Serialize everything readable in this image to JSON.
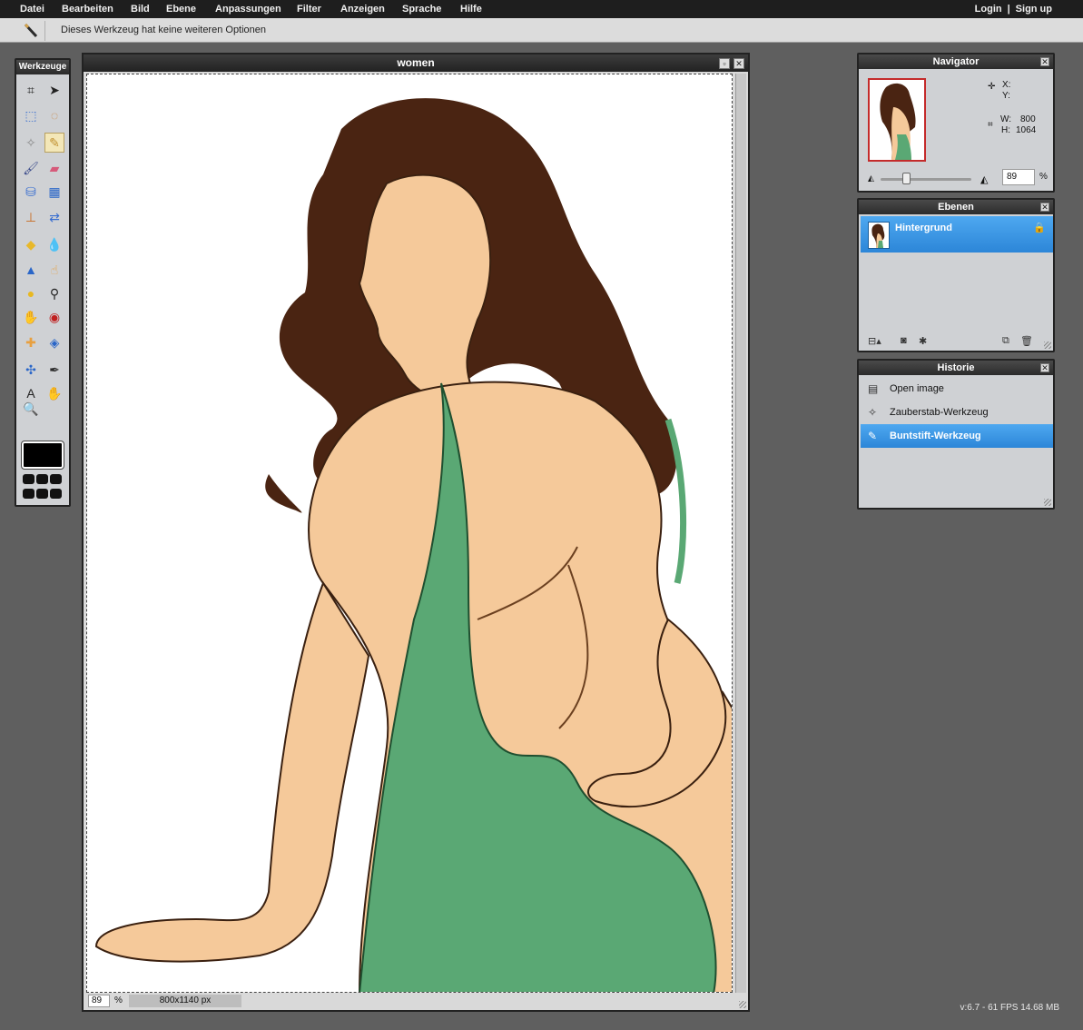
{
  "menubar": {
    "items": [
      "Datei",
      "Bearbeiten",
      "Bild",
      "Ebene",
      "Anpassungen",
      "Filter",
      "Anzeigen",
      "Sprache",
      "Hilfe"
    ],
    "login": "Login",
    "separator": "|",
    "signup": "Sign up"
  },
  "options": {
    "text": "Dieses Werkzeug hat keine weiteren Optionen",
    "active_tool_icon": "pencil-icon"
  },
  "toolbox": {
    "title": "Werkzeuge",
    "tools": [
      {
        "name": "crop-icon",
        "glyph": "⌗"
      },
      {
        "name": "move-icon",
        "glyph": "➤"
      },
      {
        "name": "marquee-icon",
        "glyph": "⬚"
      },
      {
        "name": "lasso-icon",
        "glyph": "◌"
      },
      {
        "name": "magic-wand-icon",
        "glyph": "✧"
      },
      {
        "name": "pencil-icon",
        "glyph": "✎"
      },
      {
        "name": "brush-icon",
        "glyph": "🖌"
      },
      {
        "name": "eraser-icon",
        "glyph": "▰"
      },
      {
        "name": "bucket-icon",
        "glyph": "⛁"
      },
      {
        "name": "gradient-icon",
        "glyph": "▦"
      },
      {
        "name": "clone-stamp-icon",
        "glyph": "⊥"
      },
      {
        "name": "color-replace-icon",
        "glyph": "⇄"
      },
      {
        "name": "drawing-icon",
        "glyph": "◆"
      },
      {
        "name": "blur-icon",
        "glyph": "💧"
      },
      {
        "name": "sharpen-icon",
        "glyph": "▲"
      },
      {
        "name": "smudge-icon",
        "glyph": "☝"
      },
      {
        "name": "sponge-icon",
        "glyph": "●"
      },
      {
        "name": "dodge-icon",
        "glyph": "⚲"
      },
      {
        "name": "burn-icon",
        "glyph": "✋"
      },
      {
        "name": "red-eye-icon",
        "glyph": "◉"
      },
      {
        "name": "spot-heal-icon",
        "glyph": "✚"
      },
      {
        "name": "bloat-icon",
        "glyph": "◈"
      },
      {
        "name": "pinch-icon",
        "glyph": "✣"
      },
      {
        "name": "eyedropper-icon",
        "glyph": "✒"
      },
      {
        "name": "type-icon",
        "glyph": "A"
      },
      {
        "name": "hand-icon",
        "glyph": "✋"
      },
      {
        "name": "zoom-icon",
        "glyph": "🔍"
      }
    ]
  },
  "image_window": {
    "title": "women",
    "zoom": "89",
    "zoom_unit": "%",
    "dimensions": "800x1140 px"
  },
  "navigator": {
    "title": "Navigator",
    "x_label": "X:",
    "y_label": "Y:",
    "w_label": "W:",
    "w_value": "800",
    "h_label": "H:",
    "h_value": "1064",
    "zoom": "89",
    "zoom_unit": "%"
  },
  "layers": {
    "title": "Ebenen",
    "items": [
      {
        "name": "Hintergrund",
        "locked": true
      }
    ]
  },
  "history": {
    "title": "Historie",
    "items": [
      {
        "label": "Open image",
        "icon": "document-icon"
      },
      {
        "label": "Zauberstab-Werkzeug",
        "icon": "magic-wand-icon"
      },
      {
        "label": "Buntstift-Werkzeug",
        "icon": "pencil-icon",
        "selected": true
      }
    ]
  },
  "status": {
    "version": "v:6.7 - 61 FPS 14.68 MB"
  },
  "colors": {
    "selection_blue": "#2c86d8",
    "dress_green": "#5aa874",
    "skin": "#f5c99a",
    "hair": "#4a2412"
  }
}
